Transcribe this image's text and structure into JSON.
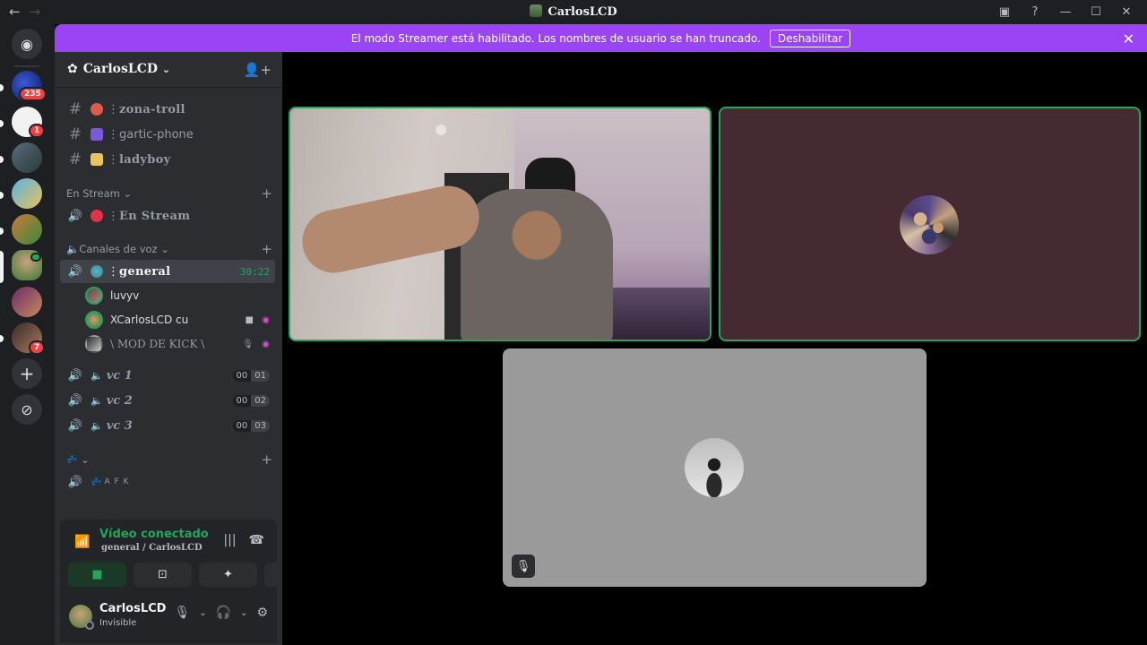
{
  "window": {
    "title": "CarlosLCD",
    "back_icon": "←",
    "forward_icon": "→",
    "inbox_icon": "▣",
    "help_icon": "?",
    "minimize_icon": "—",
    "maximize_icon": "☐",
    "close_icon": "✕"
  },
  "guilds": {
    "home_icon": "◉",
    "badges": {
      "first": "235",
      "second": "1",
      "sixth": "7"
    },
    "add_icon": "+",
    "discover_icon": "⊘"
  },
  "banner": {
    "text": "El modo Streamer está habilitado. Los nombres de usuario se han truncado.",
    "button": "Deshabilitar",
    "close": "✕"
  },
  "server": {
    "name": "CarlosLCD",
    "chevron": "⌄",
    "add_member_icon": "👤+"
  },
  "channels": {
    "text": [
      {
        "name": "zona-troll",
        "prefix": "⋮ "
      },
      {
        "name": "gartic-phone",
        "prefix": "⋮ "
      },
      {
        "name": "ladyboy",
        "prefix": "⋮ "
      }
    ],
    "cat_stream": "En Stream",
    "stream_channel": "En Stream",
    "cat_voice": "Canales de voz",
    "general": "general",
    "general_prefix": "⋮ ",
    "general_timer": "30:22",
    "members": [
      "luvyv",
      "XCarlosLCD cu",
      "\\ MOD DE KICK \\"
    ],
    "vc": [
      {
        "name": "vc 1",
        "a": "00",
        "b": "01"
      },
      {
        "name": "vc 2",
        "a": "00",
        "b": "02"
      },
      {
        "name": "vc 3",
        "a": "00",
        "b": "03"
      }
    ],
    "afk_cat_icon": "💤",
    "afk": "A F K",
    "plus": "+",
    "caret": "⌄",
    "hash": "#",
    "speaker": "🔊",
    "speaker_muted": "🔈",
    "camera_icon": "■",
    "deafen_icon": "◉",
    "mute_icon": "🎙"
  },
  "voice_panel": {
    "status": "Vídeo conectado",
    "location": "general / CarlosLCD",
    "signal_icon": "📶",
    "wave_icon": "|||",
    "disconnect_icon": "☎",
    "buttons": {
      "camera": "■",
      "screen": "⊡",
      "activities": "✦",
      "soundboard": "♪"
    }
  },
  "user": {
    "name": "CarlosLCD",
    "status": "Invisible",
    "mic_icon": "🎙",
    "caret": "⌄",
    "headphones_icon": "🎧",
    "settings_icon": "⚙"
  },
  "stage": {
    "mute_icon": "🎙"
  },
  "colors": {
    "accent": "#9b44f5",
    "speaking": "#23a55a",
    "sidebar": "#2b2d31",
    "rail": "#1e1f22"
  }
}
